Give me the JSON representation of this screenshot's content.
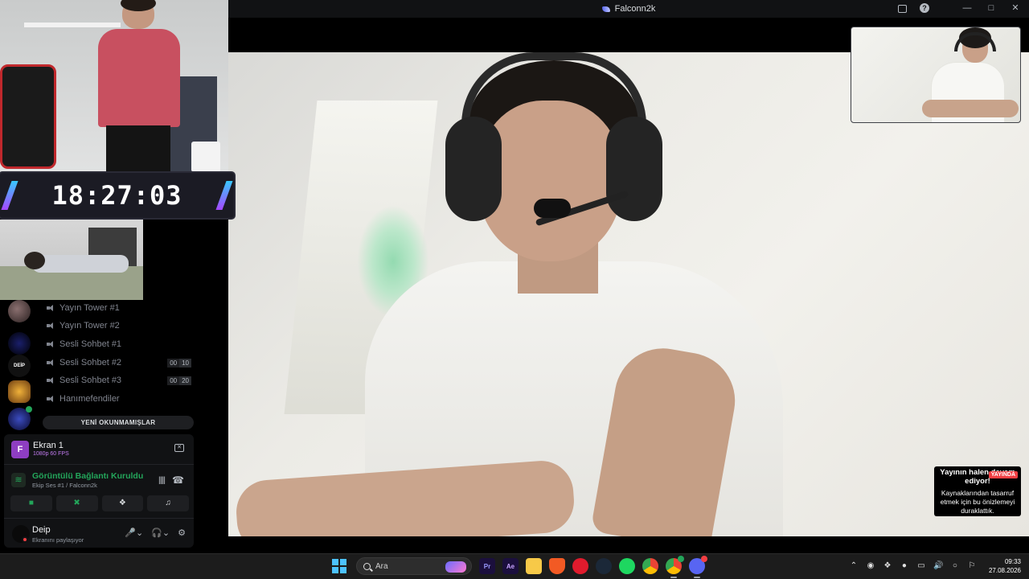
{
  "window": {
    "title": "Falconn2k"
  },
  "overlay": {
    "clock_time": "18:27:03"
  },
  "channels": [
    {
      "name": "Yayın Tower #1"
    },
    {
      "name": "Yayın Tower #2"
    },
    {
      "name": "Sesli Sohbet #1"
    },
    {
      "name": "Sesli Sohbet #2",
      "count_a": "00",
      "count_b": "10"
    },
    {
      "name": "Sesli Sohbet #3",
      "count_a": "00",
      "count_b": "20"
    },
    {
      "name": "Hanımefendiler"
    }
  ],
  "unread_label": "YENİ OKUNMAMIŞLAR",
  "stream": {
    "name": "Ekran 1",
    "quality": "1080p 60 FPS"
  },
  "connection": {
    "status": "Görüntülü Bağlantı Kuruldu",
    "detail": "Ekip Ses #1 / Falconn2k"
  },
  "user": {
    "name": "Deip",
    "status": "Ekranını paylaşıyor"
  },
  "notice": {
    "heading": "Yayının halen devam ediyor!",
    "live_badge": "YAYINDA",
    "body": "Kaynaklarından tasarruf etmek için bu önizlemeyi duraklattık."
  },
  "taskbar": {
    "search_placeholder": "Ara",
    "time": "09:33",
    "date": "27.08.2026",
    "apps": [
      "Premiere Pro",
      "After Effects",
      "File Explorer",
      "Brave",
      "Opera GX",
      "Steam",
      "Spotify",
      "Chrome",
      "Chrome Canary",
      "Discord"
    ]
  },
  "colors": {
    "accent_green": "#23a55a",
    "stream_purple": "#8e3ec2",
    "live_red": "#f23f43",
    "windows_blue": "#4cc2ff"
  }
}
